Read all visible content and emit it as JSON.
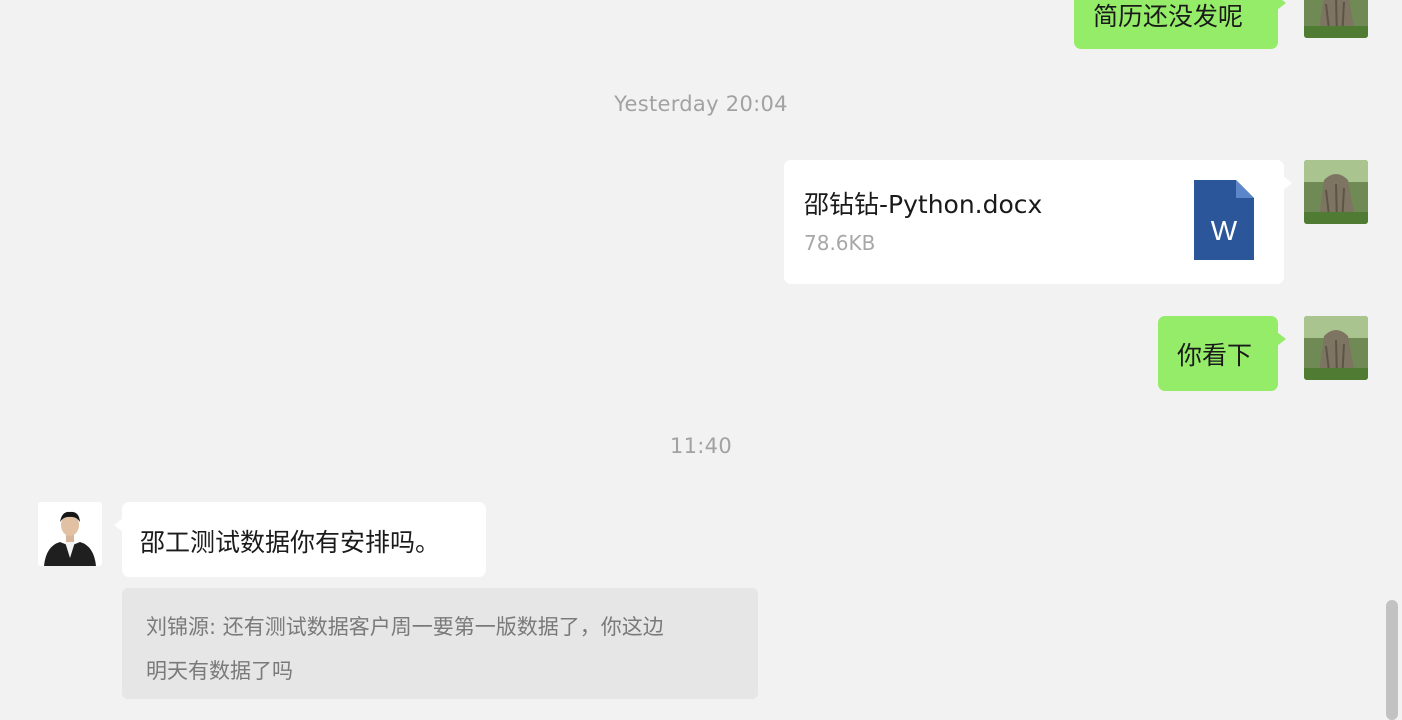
{
  "chat": {
    "messages": {
      "m1": {
        "sender": "me",
        "text": "简历还没发呢"
      },
      "m2": {
        "sender": "me",
        "file": {
          "name": "邵钻钻-Python.docx",
          "size": "78.6KB",
          "icon_letter": "W",
          "icon_color": "#2b579a"
        }
      },
      "m3": {
        "sender": "me",
        "text": "你看下"
      },
      "m4": {
        "sender": "contact",
        "text": "邵工测试数据你有安排吗。"
      }
    },
    "timestamps": {
      "t1": "Yesterday 20:04",
      "t2": "11:40"
    },
    "quote": {
      "line1": "刘锦源: 还有测试数据客户周一要第一版数据了，你这边",
      "line2": "明天有数据了吗"
    }
  },
  "colors": {
    "background": "#f2f2f2",
    "my_bubble": "#95ec69",
    "their_bubble": "#ffffff",
    "timestamp_text": "#a2a2a2",
    "quote_background": "#e6e6e6"
  }
}
